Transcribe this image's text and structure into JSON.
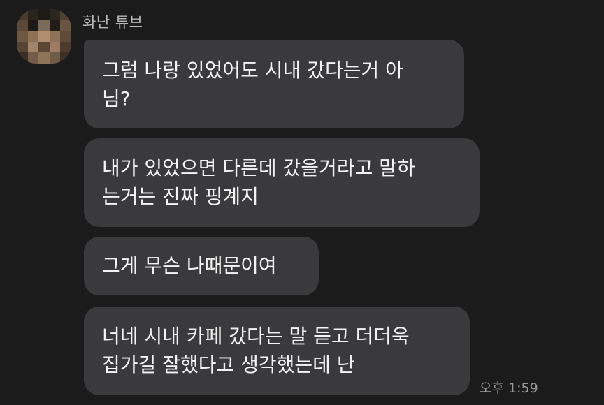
{
  "sender": {
    "name": "화난 튜브"
  },
  "messages": [
    {
      "lines": [
        "그럼 나랑 있었어도 시내 갔다는거 아",
        "님?"
      ]
    },
    {
      "lines": [
        "내가 있었으면 다른데 갔을거라고 말하",
        "는거는 진짜 핑계지"
      ]
    },
    {
      "lines": [
        "그게 무슨 나때문이여"
      ]
    },
    {
      "lines": [
        "너네 시내 카페 갔다는 말 듣고 더더욱",
        "집가길 잘했다고 생각했는데 난"
      ]
    }
  ],
  "timestamp": "오후 1:59",
  "colors": {
    "background": "#1b1b1b",
    "bubble": "#3a3a3c",
    "text": "#f4f4f4",
    "muted": "#9a9a9a"
  }
}
